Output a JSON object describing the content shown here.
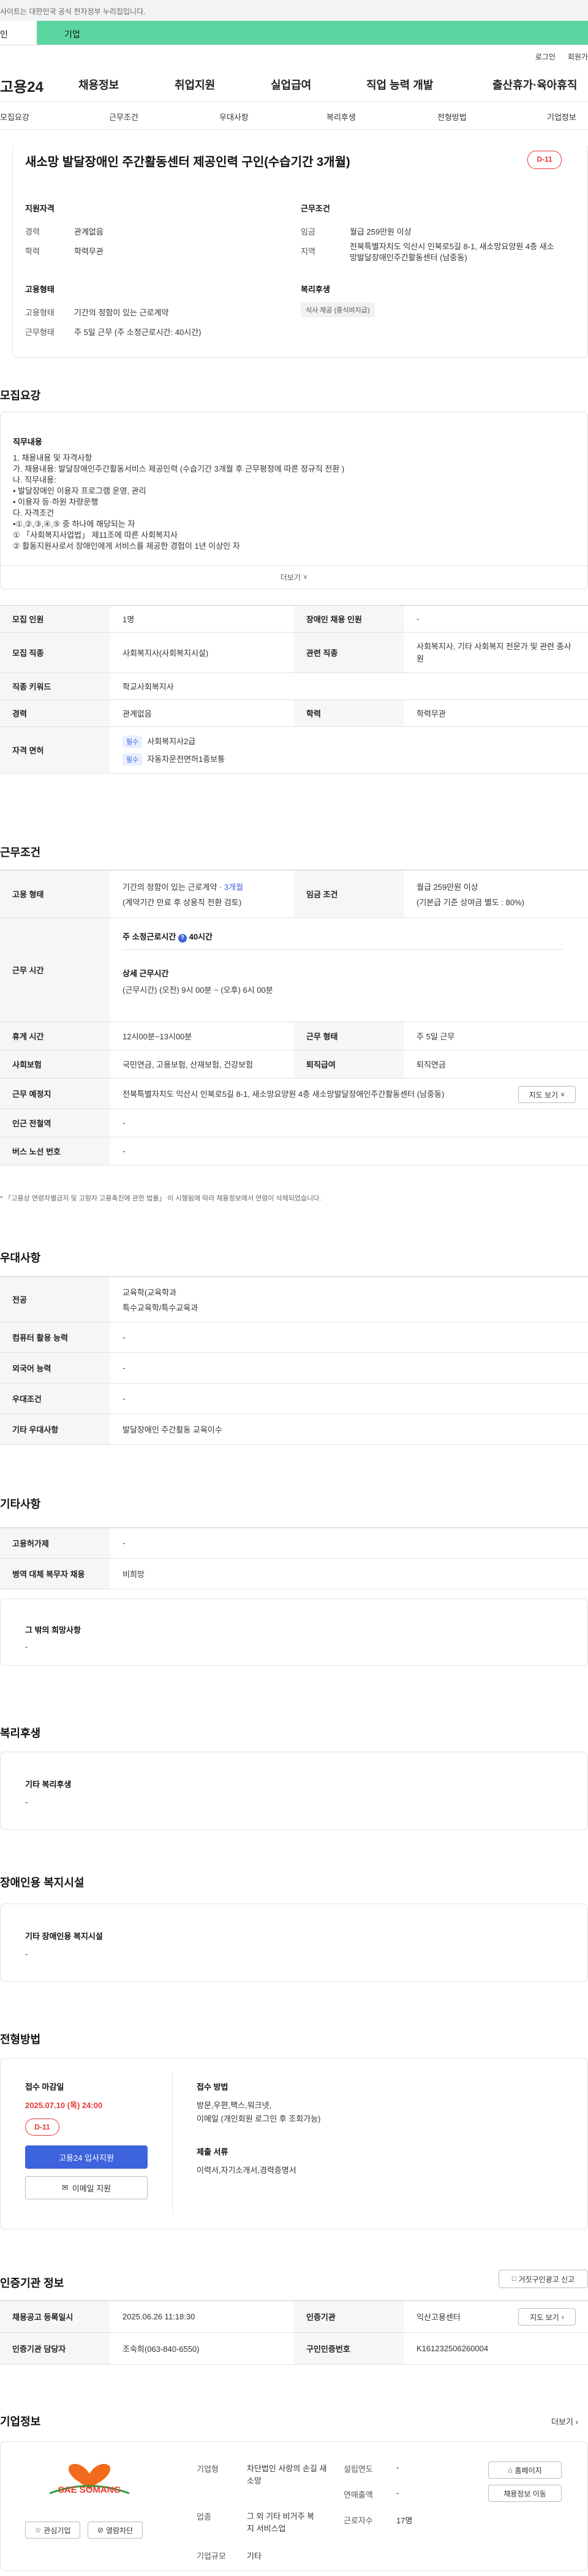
{
  "top_notice": "사이트는 대한민국 공식 전자정부 누리집입니다.",
  "tabs": {
    "person": "인",
    "corp": "기업"
  },
  "util": {
    "login": "로그인",
    "join": "회원가"
  },
  "gnb": {
    "logo": "고용24",
    "menu": [
      "채용정보",
      "취업지원",
      "실업급여",
      "직업 능력 개발",
      "출산휴가·육아휴직"
    ]
  },
  "lnb": [
    "모집요강",
    "근무조건",
    "우대사항",
    "복리후생",
    "전형방법",
    "기업정보"
  ],
  "summary": {
    "title": "새소망 발달장애인 주간활동센터 제공인력 구인(수습기간 3개월)",
    "dday": "D-11",
    "qual_title": "지원자격",
    "career_label": "경력",
    "career": "관계없음",
    "edu_label": "학력",
    "edu": "학력무관",
    "work_title": "근무조건",
    "wage_label": "임금",
    "wage": "월급 259만원 이상",
    "area_label": "지역",
    "area": "전북특별자치도 익산시 인북로5길 8-1, 새소망요양원 4층 새소망발달장애인주간활동센터 (남중동)",
    "emp_title": "고용형태",
    "emptype_label": "고용형태",
    "emptype": "기간의 정함이 있는 근로계약",
    "hours_label": "근무형태",
    "hours": "주 5일 근무 (주 소정근로시간: 40시간)",
    "welfare_title": "복리후생",
    "welfare_chip": "식사 제공 (중식비지급)"
  },
  "recruit": {
    "section": "모집요강",
    "job_title": "직무내용",
    "job_lines": [
      "1. 채용내용 및 자격사항",
      "가. 채용내용: 발달장애인주간활동서비스 제공인력 (수습기간 3개월 후 근무평정에 따른 정규직 전환 )",
      "나. 직무내용:",
      "• 발달장애인 이용자 프로그램 운영, 관리",
      "• 이용자 등·하원 차량운행",
      "다. 자격조건",
      "•①,②,③,④,⑤ 중 하나에 해당되는 자",
      "① 「사회복지사업법」 제11조에 따른 사회복지사",
      "② 활동지원사로서 장애인에게 서비스를 제공한 경험이 1년 이상인 자"
    ],
    "more": "더보기",
    "rows": [
      {
        "k1": "모집 인원",
        "v1": "1명",
        "k2": "장애인 채용 인원",
        "v2": "-"
      },
      {
        "k1": "모집 직종",
        "v1": "사회복지사(사회복지시설)",
        "k2": "관련 직종",
        "v2": "사회복지사, 기타 사회복지 전문가 및 관련 종사원"
      },
      {
        "k1": "직종 키워드",
        "v1": "학교사회복지사"
      },
      {
        "k1": "경력",
        "v1": "관계없음",
        "k2": "학력",
        "v2": "학력무관"
      }
    ],
    "license_label": "자격 면허",
    "licenses": [
      {
        "tag": "필수",
        "name": "사회복지사2급"
      },
      {
        "tag": "필수",
        "name": "자동차운전면허1종보통"
      }
    ]
  },
  "work": {
    "section": "근무조건",
    "emp_label": "고용 형태",
    "emp_v1": "기간의 정함이 있는 근로계약 · ",
    "emp_v1b": "3개월",
    "emp_v2": "(계약기간 만료 후 상용직 전환 검토)",
    "wage_label": "임금 조건",
    "wage_v1": "월급 259만원 이상",
    "wage_v2": "(기본급 기준 상여금 별도 : 80%)",
    "time_label": "근무 시간",
    "weekly": "주 소정근로시간",
    "weekly_v": "40시간",
    "detail_title": "상세 근무시간",
    "detail": "(근무시간) (오전) 9시 00분 ~ (오후) 6시 00분",
    "rest_label": "휴게 시간",
    "rest": "12시00분~13시00분",
    "form_label": "근무 형태",
    "form": "주 5일 근무",
    "ins_label": "사회보험",
    "ins": "국민연금, 고용보험, 산재보험, 건강보험",
    "retire_label": "퇴직급여",
    "retire": "퇴직연금",
    "place_label": "근무 예정지",
    "place": "전북특별자치도 익산시 인북로5길 8-1, 새소망요양원 4층 새소망발달장애인주간활동센터 (남중동)",
    "map_btn": "지도 보기",
    "subway_label": "인근 전철역",
    "subway": "-",
    "bus_label": "버스 노선 번호",
    "bus": "-",
    "footnote": "「고용상 연령차별금지 및 고령자 고용촉진에 관한 법률」 이 시행됨에 따라 채용정보에서 연령이 삭제되었습니다."
  },
  "pref": {
    "section": "우대사항",
    "major_label": "전공",
    "major1": "교육학(교육학과",
    "major2": "특수교육학/특수교육과",
    "pc_label": "컴퓨터 활용 능력",
    "pc": "-",
    "lang_label": "외국어 능력",
    "lang": "-",
    "cond_label": "우대조건",
    "cond": "-",
    "etc_label": "기타 우대사항",
    "etc": "발달장애인 주간활동 교육이수"
  },
  "other": {
    "section": "기타사항",
    "resign_label": "고용허가제",
    "resign": "-",
    "mil_label": "병역 대체 복무자 채용",
    "mil": "비희망",
    "hope_title": "그 밖의 희망사항",
    "hope": "-"
  },
  "welfare": {
    "section": "복리후생",
    "title": "기타 복리후생",
    "value": "-"
  },
  "disab": {
    "section": "장애인용 복지시설",
    "title": "기타 장애인용 복지시설",
    "value": "-"
  },
  "process": {
    "section": "전형방법",
    "deadline_title": "접수 마감일",
    "deadline": "2025.07.10 (목) 24:00",
    "dday": "D-11",
    "apply_btn": "고용24 입사지원",
    "email_btn": "이메일 지원",
    "method_title": "접수 방법",
    "method1": "방문,우편,팩스,워크넷,",
    "method2": "이메일 (개인회원 로그인 후 조회가능)",
    "docs_title": "제출 서류",
    "docs": "이력서,자기소개서,경력증명서"
  },
  "agency": {
    "section": "인증기관 정보",
    "report_btn": "거짓구인광고 신고",
    "reg_label": "채용공고 등록일시",
    "reg": "2025.06.26 11:18:30",
    "org_label": "인증기관",
    "org": "익산고용센터",
    "map_btn": "지도 보기",
    "mgr_label": "인증기관 담당자",
    "mgr": "조숙희(063-840-6550)",
    "no_label": "구인인증번호",
    "no": "K161232506260004"
  },
  "company": {
    "section": "기업정보",
    "more": "더보기",
    "logo_text": "SAE SOMANG",
    "fav_btn": "관심기업",
    "block_btn": "열람차단",
    "type_label": "기업형",
    "type": "차단법인 사랑의 손길 새소망",
    "ind_label": "업종",
    "ind": "그 외 기타 비거주 복지 서비스업",
    "year_label": "설립연도",
    "year": "-",
    "sales_label": "연매출액",
    "sales": "-",
    "emp_label": "근로자수",
    "emp": "17명",
    "addr_label": "기업규모",
    "addr": "기타",
    "home_btn": "홈페이지",
    "jobs_btn": "채용정보 이동"
  }
}
